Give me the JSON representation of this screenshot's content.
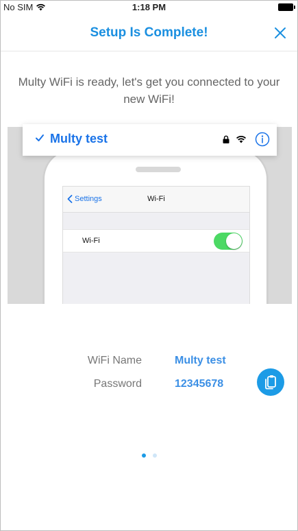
{
  "status_bar": {
    "carrier": "No SIM",
    "time": "1:18 PM"
  },
  "header": {
    "title": "Setup Is Complete!"
  },
  "intro_text": "Multy WiFi is ready, let's get you connected to your new WiFi!",
  "illustration": {
    "back_label": "Settings",
    "screen_title": "Wi-Fi",
    "wifi_row_label": "Wi-Fi",
    "wifi_toggle_on": true,
    "network_name": "Multy test"
  },
  "credentials": {
    "name_label": "WiFi Name",
    "name_value": "Multy test",
    "password_label": "Password",
    "password_value": "12345678"
  },
  "pager": {
    "total": 2,
    "current": 1
  },
  "colors": {
    "accent": "#1a8fe0",
    "link": "#1a73e8",
    "toggle_on": "#4cd964",
    "copy_button": "#1c9be6",
    "dot_active": "#1c9be6",
    "dot_inactive": "#cfe6f8"
  },
  "icons": {
    "close": "close-icon",
    "check": "checkmark-icon",
    "lock": "lock-icon",
    "wifi": "wifi-icon",
    "info": "info-icon",
    "copy": "copy-icon",
    "back": "chevron-left-icon"
  }
}
